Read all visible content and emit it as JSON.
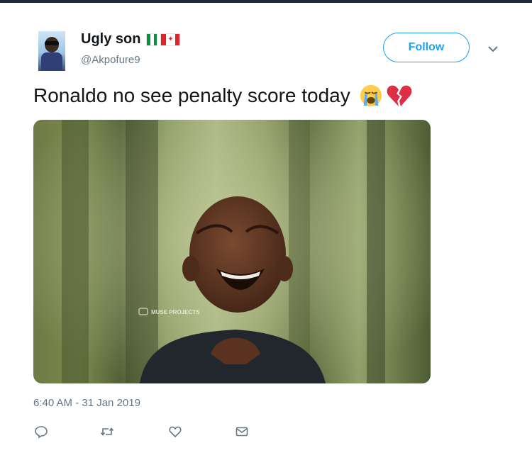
{
  "tweet": {
    "author": {
      "display_name": "Ugly son",
      "handle": "@Akpofure9",
      "avatar_icon": "avatar-photo",
      "flags": [
        "nigeria-flag",
        "canada-flag"
      ]
    },
    "follow_label": "Follow",
    "text": "Ronaldo no see penalty score today",
    "emojis": [
      "loudly-crying-face-icon",
      "broken-heart-icon"
    ],
    "media": {
      "watermark": "MUSE PROJECTS"
    },
    "timestamp": "6:40 AM - 31 Jan 2019",
    "actions": [
      "reply-icon",
      "retweet-icon",
      "like-icon",
      "direct-message-icon"
    ]
  },
  "colors": {
    "accent": "#1da1f2",
    "text_primary": "#14171a",
    "text_secondary": "#657786"
  }
}
